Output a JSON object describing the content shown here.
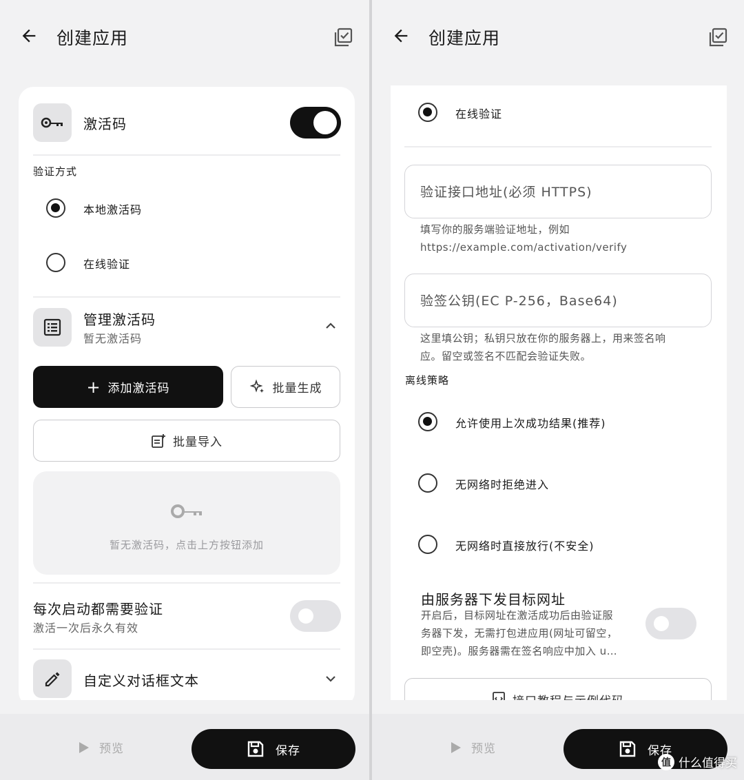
{
  "left": {
    "appbar": {
      "title": "创建应用"
    },
    "activation": {
      "title": "激活码",
      "enabled": true
    },
    "verify_method_label": "验证方式",
    "verify_options": [
      {
        "label": "本地激活码",
        "selected": true
      },
      {
        "label": "在线验证",
        "selected": false
      }
    ],
    "manage": {
      "title": "管理激活码",
      "subtitle": "暂无激活码"
    },
    "add_button": "添加激活码",
    "batch_generate_button": "批量生成",
    "batch_import_button": "批量导入",
    "empty_text": "暂无激活码，点击上方按钮添加",
    "verify_each_launch": {
      "title": "每次启动都需要验证",
      "subtitle": "激活一次后永久有效",
      "enabled": false
    },
    "custom_dialog": {
      "title": "自定义对话框文本"
    },
    "bottom": {
      "preview": "预览",
      "save": "保存"
    }
  },
  "right": {
    "appbar": {
      "title": "创建应用"
    },
    "online_option": {
      "label": "在线验证",
      "selected": true
    },
    "endpoint_field": {
      "placeholder": "验证接口地址(必须 HTTPS)"
    },
    "endpoint_helper": {
      "line1": "填写你的服务端验证地址，例如",
      "line2": "https://example.com/activation/verify"
    },
    "pubkey_field": {
      "placeholder": "验签公钥(EC P-256，Base64)"
    },
    "pubkey_helper": {
      "line1": "这里填公钥；私钥只放在你的服务器上，用来签名响",
      "line2": "应。留空或签名不匹配会验证失败。"
    },
    "offline_label": "离线策略",
    "offline_options": [
      {
        "label": "允许使用上次成功结果(推荐)",
        "selected": true
      },
      {
        "label": "无网络时拒绝进入",
        "selected": false
      },
      {
        "label": "无网络时直接放行(不安全)",
        "selected": false
      }
    ],
    "server_url": {
      "title": "由服务器下发目标网址",
      "desc1": "开启后，目标网址在激活成功后由验证服",
      "desc2": "务器下发，无需打包进应用(网址可留空，",
      "desc3": "即空壳)。服务器需在签名响应中加入 u…",
      "enabled": false
    },
    "tutorial_button": "接口教程与示例代码",
    "bottom": {
      "preview": "预览",
      "save": "保存"
    }
  },
  "watermark": {
    "badge": "值",
    "text": "什么值得买"
  },
  "colors": {
    "accent": "#111111",
    "surface": "#ffffff",
    "background": "#f2f2f3",
    "muted": "#9a9a9e"
  }
}
